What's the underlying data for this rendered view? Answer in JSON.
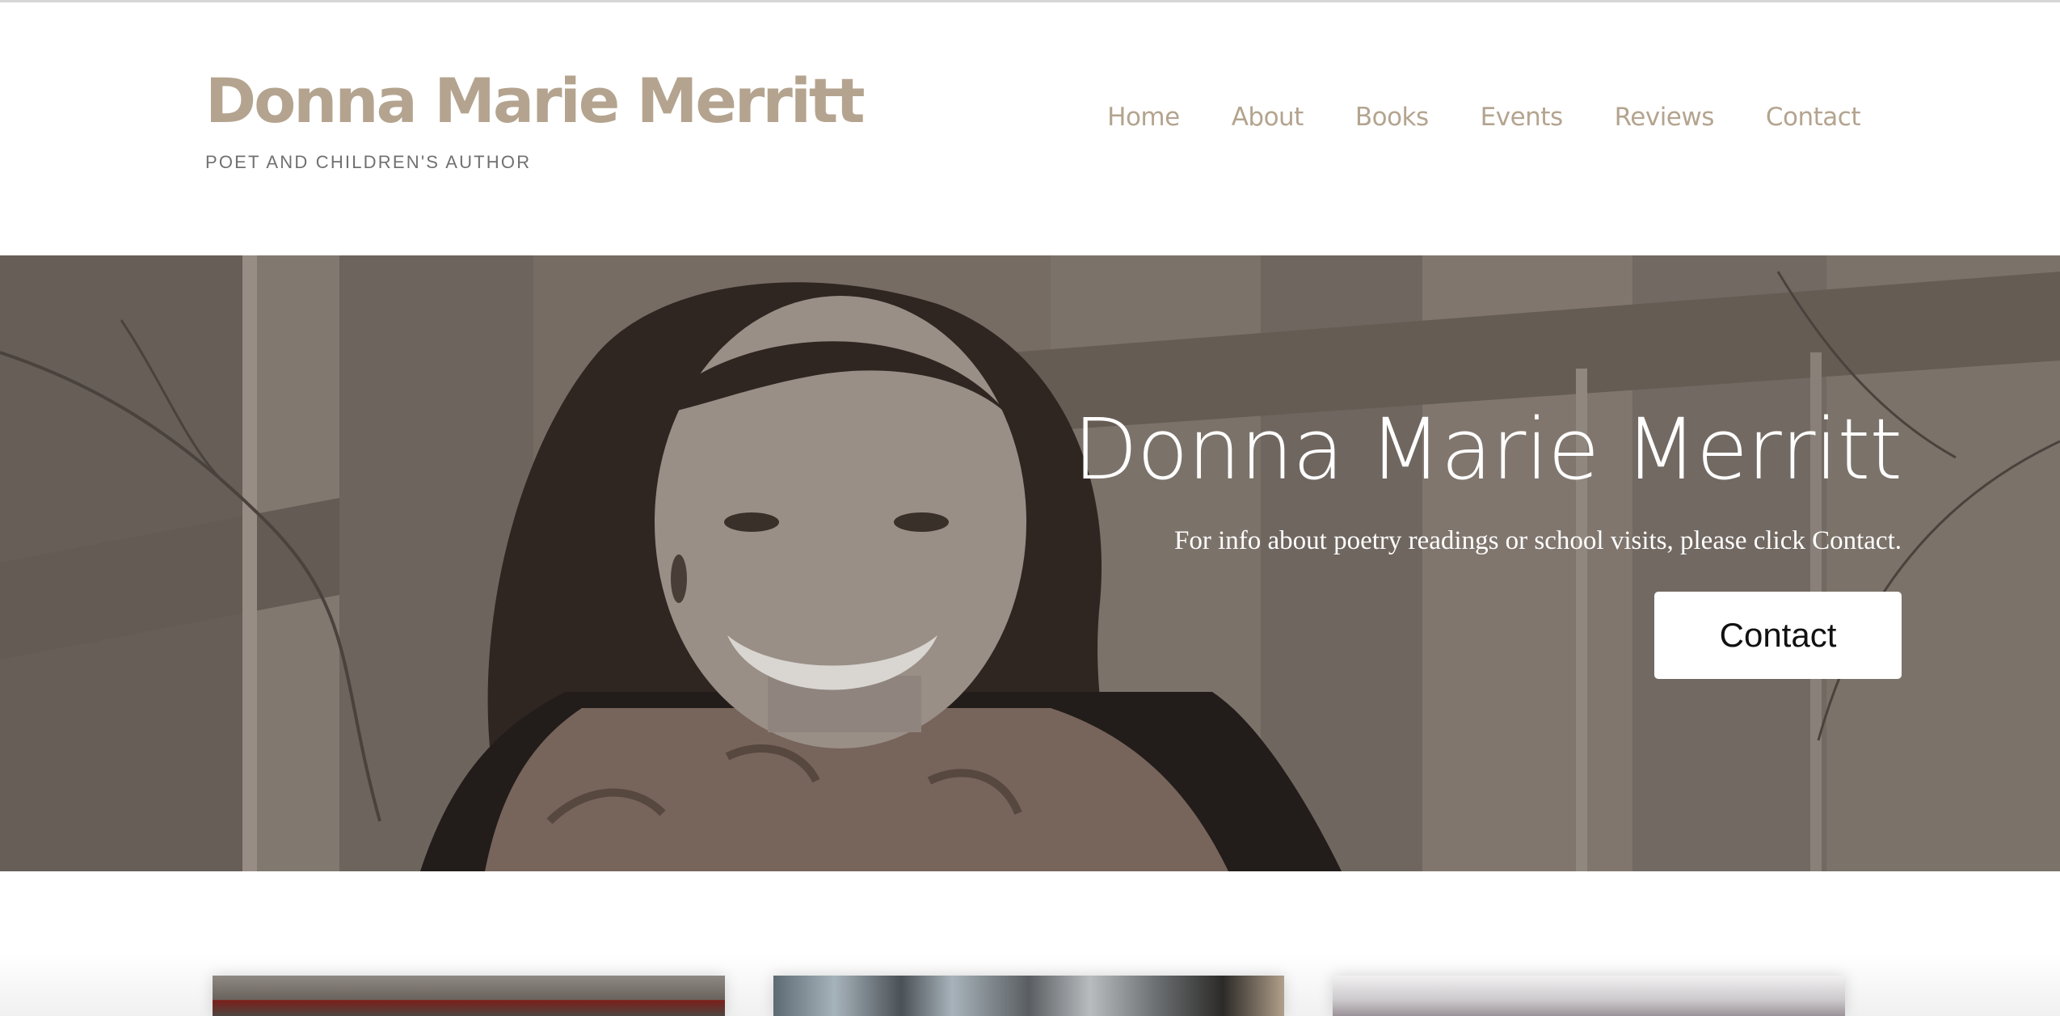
{
  "header": {
    "site_title": "Donna Marie Merritt",
    "tagline": "POET AND CHILDREN'S AUTHOR",
    "nav": [
      "Home",
      "About",
      "Books",
      "Events",
      "Reviews",
      "Contact"
    ]
  },
  "hero": {
    "title": "Donna Marie Merritt",
    "subtitle": "For info about poetry readings or school visits, please click Contact.",
    "button_label": "Contact"
  },
  "colors": {
    "brand": "#b4a48f",
    "tagline": "#707070",
    "hero_text": "#ffffff"
  }
}
